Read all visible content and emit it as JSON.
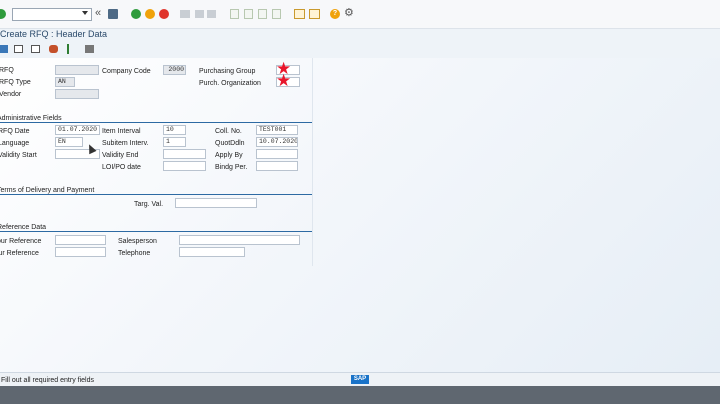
{
  "toolbar": {
    "command_value": "",
    "icons": [
      "enter-icon",
      "command-dropdown-icon",
      "collapse-icon",
      "save-icon",
      "back-icon",
      "exit-icon",
      "cancel-icon",
      "print-icon",
      "find-icon",
      "find-next-icon",
      "first-page-icon",
      "prev-page-icon",
      "next-page-icon",
      "last-page-icon",
      "new-session-icon",
      "shortcut-icon",
      "help-icon",
      "settings-icon"
    ]
  },
  "title": "Create RFQ : Header Data",
  "app_toolbar": {
    "icons": [
      "org-data-icon",
      "header-details-icon",
      "texts-icon",
      "partners-icon",
      "status-flag-icon",
      "print-preview-icon"
    ]
  },
  "header": {
    "rfq_label": "RFQ",
    "rfq_type_label": "RFQ Type",
    "rfq_type_value": "AN",
    "vendor_label": "Vendor",
    "company_code_label": "Company Code",
    "company_code_value": "2000",
    "purchasing_group_label": "Purchasing Group",
    "purch_org_label": "Purch. Organization"
  },
  "sections": {
    "admin": "Administrative Fields",
    "delivery": "Terms of Delivery and Payment",
    "reference": "Reference Data"
  },
  "admin": {
    "rfq_date_label": "RFQ Date",
    "rfq_date_value": "01.07.2020",
    "language_label": "Language",
    "language_value": "EN",
    "validity_start_label": "Validity Start",
    "item_interval_label": "Item Interval",
    "item_interval_value": "10",
    "subitem_interv_label": "Subitem Interv.",
    "subitem_interv_value": "1",
    "validity_end_label": "Validity End",
    "loi_po_date_label": "LOI/PO date",
    "coll_no_label": "Coll. No.",
    "coll_no_value": "TEST001",
    "quotddln_label": "QuotDdln",
    "quotddln_value": "10.07.2020",
    "apply_by_label": "Apply By",
    "bindg_per_label": "Bindg Per."
  },
  "delivery": {
    "targ_val_label": "Targ. Val."
  },
  "reference": {
    "your_reference_label": "Your Reference",
    "our_reference_label": "Our Reference",
    "salesperson_label": "Salesperson",
    "telephone_label": "Telephone"
  },
  "status": {
    "message": "Fill out all required entry fields",
    "logo": "SAP"
  },
  "colors": {
    "required_star": "#e8162b",
    "section_line": "#2d6aa3",
    "enter_green": "#2e9b3c"
  }
}
